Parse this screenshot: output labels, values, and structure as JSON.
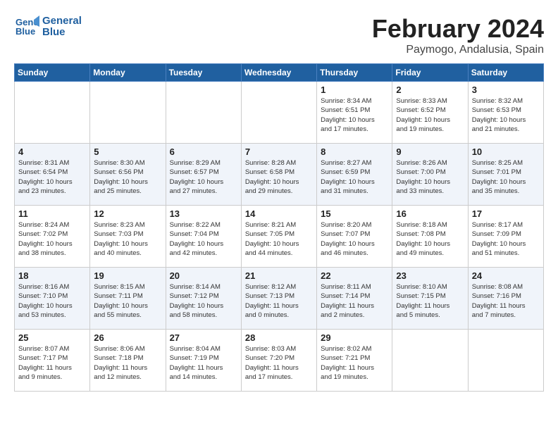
{
  "logo": {
    "line1": "General",
    "line2": "Blue"
  },
  "title": "February 2024",
  "location": "Paymogo, Andalusia, Spain",
  "weekdays": [
    "Sunday",
    "Monday",
    "Tuesday",
    "Wednesday",
    "Thursday",
    "Friday",
    "Saturday"
  ],
  "weeks": [
    [
      {
        "day": "",
        "info": ""
      },
      {
        "day": "",
        "info": ""
      },
      {
        "day": "",
        "info": ""
      },
      {
        "day": "",
        "info": ""
      },
      {
        "day": "1",
        "info": "Sunrise: 8:34 AM\nSunset: 6:51 PM\nDaylight: 10 hours\nand 17 minutes."
      },
      {
        "day": "2",
        "info": "Sunrise: 8:33 AM\nSunset: 6:52 PM\nDaylight: 10 hours\nand 19 minutes."
      },
      {
        "day": "3",
        "info": "Sunrise: 8:32 AM\nSunset: 6:53 PM\nDaylight: 10 hours\nand 21 minutes."
      }
    ],
    [
      {
        "day": "4",
        "info": "Sunrise: 8:31 AM\nSunset: 6:54 PM\nDaylight: 10 hours\nand 23 minutes."
      },
      {
        "day": "5",
        "info": "Sunrise: 8:30 AM\nSunset: 6:56 PM\nDaylight: 10 hours\nand 25 minutes."
      },
      {
        "day": "6",
        "info": "Sunrise: 8:29 AM\nSunset: 6:57 PM\nDaylight: 10 hours\nand 27 minutes."
      },
      {
        "day": "7",
        "info": "Sunrise: 8:28 AM\nSunset: 6:58 PM\nDaylight: 10 hours\nand 29 minutes."
      },
      {
        "day": "8",
        "info": "Sunrise: 8:27 AM\nSunset: 6:59 PM\nDaylight: 10 hours\nand 31 minutes."
      },
      {
        "day": "9",
        "info": "Sunrise: 8:26 AM\nSunset: 7:00 PM\nDaylight: 10 hours\nand 33 minutes."
      },
      {
        "day": "10",
        "info": "Sunrise: 8:25 AM\nSunset: 7:01 PM\nDaylight: 10 hours\nand 35 minutes."
      }
    ],
    [
      {
        "day": "11",
        "info": "Sunrise: 8:24 AM\nSunset: 7:02 PM\nDaylight: 10 hours\nand 38 minutes."
      },
      {
        "day": "12",
        "info": "Sunrise: 8:23 AM\nSunset: 7:03 PM\nDaylight: 10 hours\nand 40 minutes."
      },
      {
        "day": "13",
        "info": "Sunrise: 8:22 AM\nSunset: 7:04 PM\nDaylight: 10 hours\nand 42 minutes."
      },
      {
        "day": "14",
        "info": "Sunrise: 8:21 AM\nSunset: 7:05 PM\nDaylight: 10 hours\nand 44 minutes."
      },
      {
        "day": "15",
        "info": "Sunrise: 8:20 AM\nSunset: 7:07 PM\nDaylight: 10 hours\nand 46 minutes."
      },
      {
        "day": "16",
        "info": "Sunrise: 8:18 AM\nSunset: 7:08 PM\nDaylight: 10 hours\nand 49 minutes."
      },
      {
        "day": "17",
        "info": "Sunrise: 8:17 AM\nSunset: 7:09 PM\nDaylight: 10 hours\nand 51 minutes."
      }
    ],
    [
      {
        "day": "18",
        "info": "Sunrise: 8:16 AM\nSunset: 7:10 PM\nDaylight: 10 hours\nand 53 minutes."
      },
      {
        "day": "19",
        "info": "Sunrise: 8:15 AM\nSunset: 7:11 PM\nDaylight: 10 hours\nand 55 minutes."
      },
      {
        "day": "20",
        "info": "Sunrise: 8:14 AM\nSunset: 7:12 PM\nDaylight: 10 hours\nand 58 minutes."
      },
      {
        "day": "21",
        "info": "Sunrise: 8:12 AM\nSunset: 7:13 PM\nDaylight: 11 hours\nand 0 minutes."
      },
      {
        "day": "22",
        "info": "Sunrise: 8:11 AM\nSunset: 7:14 PM\nDaylight: 11 hours\nand 2 minutes."
      },
      {
        "day": "23",
        "info": "Sunrise: 8:10 AM\nSunset: 7:15 PM\nDaylight: 11 hours\nand 5 minutes."
      },
      {
        "day": "24",
        "info": "Sunrise: 8:08 AM\nSunset: 7:16 PM\nDaylight: 11 hours\nand 7 minutes."
      }
    ],
    [
      {
        "day": "25",
        "info": "Sunrise: 8:07 AM\nSunset: 7:17 PM\nDaylight: 11 hours\nand 9 minutes."
      },
      {
        "day": "26",
        "info": "Sunrise: 8:06 AM\nSunset: 7:18 PM\nDaylight: 11 hours\nand 12 minutes."
      },
      {
        "day": "27",
        "info": "Sunrise: 8:04 AM\nSunset: 7:19 PM\nDaylight: 11 hours\nand 14 minutes."
      },
      {
        "day": "28",
        "info": "Sunrise: 8:03 AM\nSunset: 7:20 PM\nDaylight: 11 hours\nand 17 minutes."
      },
      {
        "day": "29",
        "info": "Sunrise: 8:02 AM\nSunset: 7:21 PM\nDaylight: 11 hours\nand 19 minutes."
      },
      {
        "day": "",
        "info": ""
      },
      {
        "day": "",
        "info": ""
      }
    ]
  ]
}
